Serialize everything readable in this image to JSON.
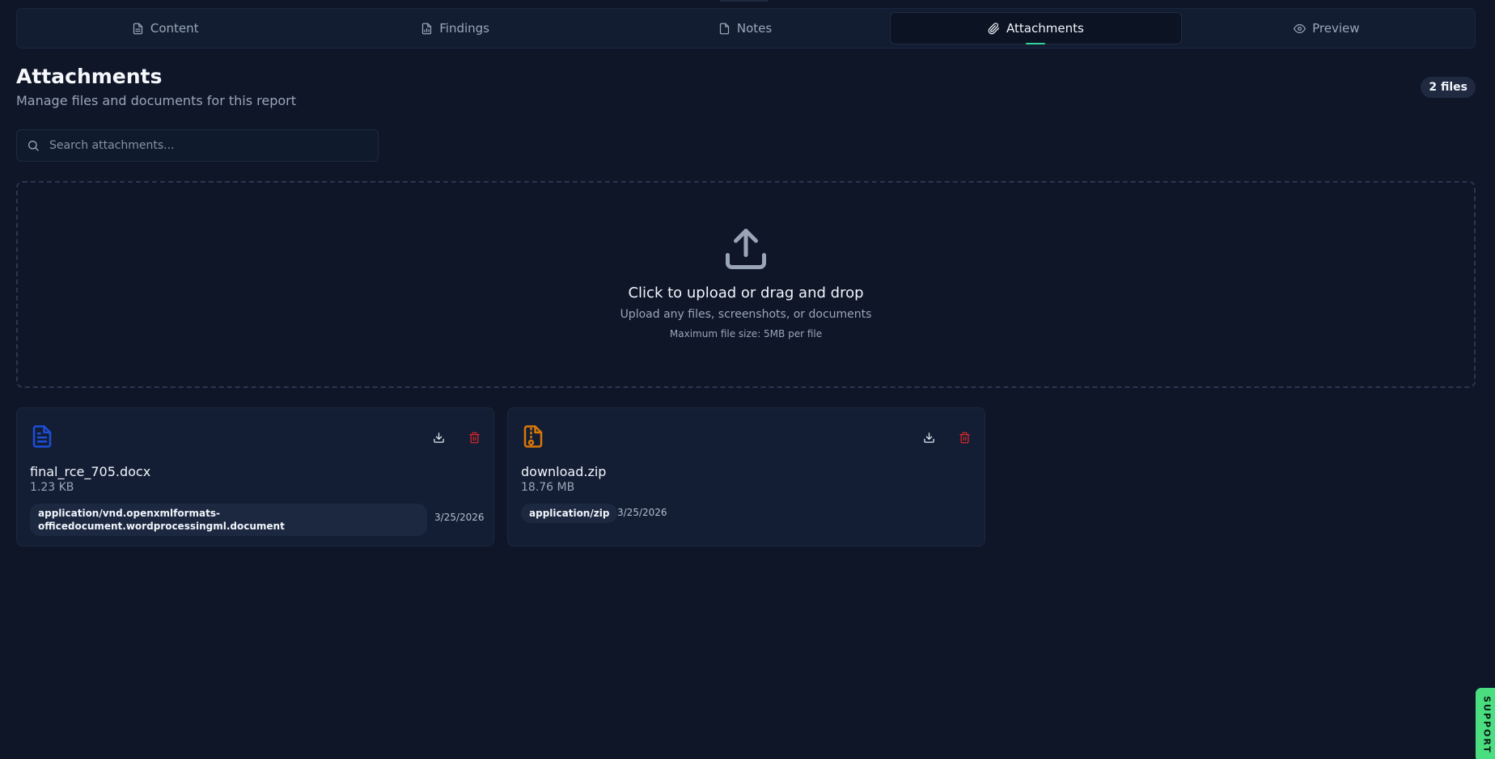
{
  "tabs": [
    {
      "label": "Content",
      "icon": "file-text-icon"
    },
    {
      "label": "Findings",
      "icon": "file-chart-icon"
    },
    {
      "label": "Notes",
      "icon": "file-icon"
    },
    {
      "label": "Attachments",
      "icon": "paperclip-icon",
      "active": true
    },
    {
      "label": "Preview",
      "icon": "eye-icon"
    }
  ],
  "header": {
    "title": "Attachments",
    "subtitle": "Manage files and documents for this report",
    "count_badge": "2 files"
  },
  "search": {
    "placeholder": "Search attachments..."
  },
  "dropzone": {
    "title": "Click to upload or drag and drop",
    "subtitle": "Upload any files, screenshots, or documents",
    "limit": "Maximum file size: 5MB per file"
  },
  "attachments": [
    {
      "name": "final_rce_705.docx",
      "size": "1.23 KB",
      "mime": "application/vnd.openxmlformats-officedocument.wordprocessingml.document",
      "date": "3/25/2026",
      "icon": "file-text-icon",
      "icon_color": "#1d4ed8"
    },
    {
      "name": "download.zip",
      "size": "18.76 MB",
      "mime": "application/zip",
      "date": "3/25/2026",
      "icon": "file-archive-icon",
      "icon_color": "#d97706"
    }
  ],
  "support": {
    "label": "SUPPORT"
  },
  "colors": {
    "background": "#0e1628",
    "accent": "#34d399",
    "delete": "#dc2626",
    "support": "#4ade80"
  }
}
